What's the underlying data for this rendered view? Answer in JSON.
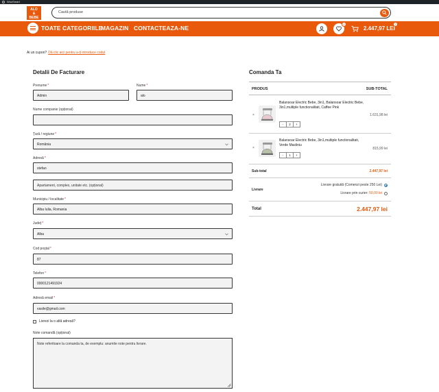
{
  "browser": {
    "title": "WooSmart"
  },
  "brand": {
    "logo_text": "ALO BEBE",
    "accent": "#e8590c"
  },
  "header": {
    "search_placeholder": "Caută produse"
  },
  "nav": {
    "menu": [
      "TOATE CATEGORIILE",
      "MAGAZIN",
      "CONTACTEAZA-NE"
    ],
    "wishlist_count": "0",
    "cart_count": "3",
    "cart_total": "2.447,97 LEI"
  },
  "coupon": {
    "text": "Ai un cupon?",
    "link": "Dă clic aici pentru a-ți introduce codul"
  },
  "billing": {
    "title": "Detalii De Facturare",
    "required_mark": "*",
    "first_name": {
      "label": "Prenume",
      "value": "Admin"
    },
    "last_name": {
      "label": "Nume",
      "value": "alo"
    },
    "company": {
      "label": "Nume companie (opțional)",
      "value": ""
    },
    "country": {
      "label": "Țară / regiune",
      "value": "România"
    },
    "address": {
      "label": "Adresă",
      "value": "stefan",
      "placeholder2": "Apartament, complex, unitate etc. (opțional)"
    },
    "city": {
      "label": "Municipiu / localitate",
      "value": "Alba Iulia, Romania"
    },
    "county": {
      "label": "Județ",
      "value": "Alba"
    },
    "postcode": {
      "label": "Cod poștal",
      "value": "87"
    },
    "phone": {
      "label": "Telefon",
      "value": "0000121491924"
    },
    "email": {
      "label": "Adresă email",
      "value": "vasile@gmail.com"
    },
    "ship_other": {
      "label": "Livrezi la o altă adresă?"
    },
    "notes": {
      "label": "Note comandă (opțional)",
      "placeholder": "Note referitoare la comanda ta, de exemplu: anumite note pentru livrare."
    }
  },
  "order": {
    "title": "Comanda Ta",
    "col_product": "PRODUS",
    "col_subtotal": "SUB-TOTAL",
    "items": [
      {
        "name": "Balansoar Electric Bebe, 3in1, Balansoar Electric Bebe, 3in1,multiple functionalitati, Caffee Pink",
        "qty": "2",
        "price": "1.631,98 lei"
      },
      {
        "name": "Balansoar Electric Bebe, 3in1,multiple functionalitati, Verde Masliniu",
        "qty": "1",
        "price": "815,99 lei"
      }
    ],
    "remove_symbol": "×",
    "minus": "-",
    "plus": "+",
    "subtotal_label": "Sub-total",
    "subtotal_value": "2.447,97 lei",
    "shipping_label": "Livrare",
    "ship_free": "Livrare gratuită (Comenzi peste 250 Lei)",
    "ship_courier": "Livrare prin curier:",
    "ship_courier_price": "50,00 lei",
    "total_label": "Total",
    "total_value": "2.447,97 lei"
  }
}
